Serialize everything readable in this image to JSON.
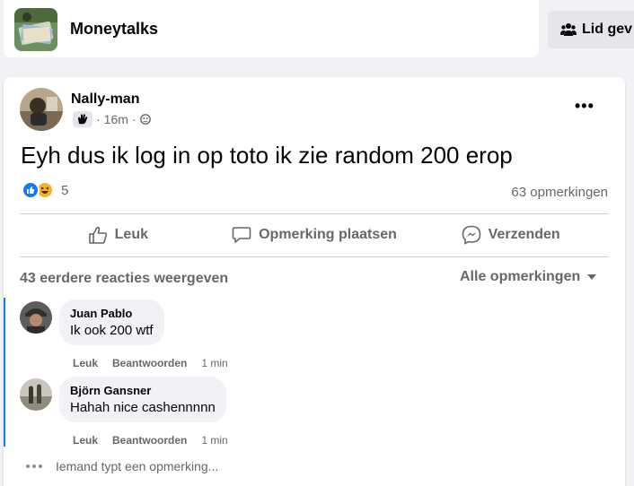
{
  "group": {
    "name": "Moneytalks",
    "join_label": "Lid gev"
  },
  "post": {
    "author": "Nally-man",
    "time": "16m",
    "text": "Eyh dus ik log in op toto ik zie random 200 erop",
    "reaction_count": "5",
    "comments_count": "63 opmerkingen"
  },
  "actions": {
    "like": "Leuk",
    "comment": "Opmerking plaatsen",
    "share": "Verzenden"
  },
  "comments_section": {
    "previous": "43 eerdere reacties weergeven",
    "filter": "Alle opmerkingen"
  },
  "comments": [
    {
      "name": "Juan Pablo",
      "text": "Ik ook 200 wtf",
      "like": "Leuk",
      "reply": "Beantwoorden",
      "time": "1 min"
    },
    {
      "name": "Björn Gansner",
      "text": "Hahah nice cashennnnn",
      "like": "Leuk",
      "reply": "Beantwoorden",
      "time": "1 min"
    }
  ],
  "typing": "Iemand typt een opmerking...",
  "colors": {
    "accent": "#1877f2",
    "haha": "#f7b125",
    "secondary_text": "#65676b",
    "bubble": "#f0f2f5"
  },
  "icons": [
    "people-icon",
    "wave-badge-icon",
    "globe-icon",
    "more-icon",
    "like-reaction-icon",
    "haha-reaction-icon",
    "thumbs-up-icon",
    "comment-icon",
    "messenger-icon",
    "caret-down-icon",
    "typing-dots-icon"
  ]
}
